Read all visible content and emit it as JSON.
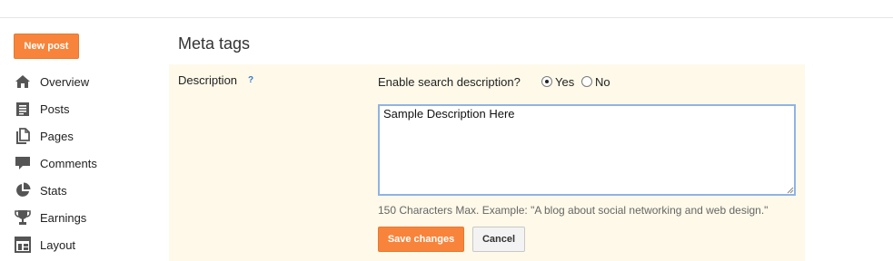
{
  "sidebar": {
    "new_post_label": "New post",
    "items": [
      {
        "label": "Overview",
        "icon": "home-icon"
      },
      {
        "label": "Posts",
        "icon": "posts-icon"
      },
      {
        "label": "Pages",
        "icon": "pages-icon"
      },
      {
        "label": "Comments",
        "icon": "comment-icon"
      },
      {
        "label": "Stats",
        "icon": "pie-chart-icon"
      },
      {
        "label": "Earnings",
        "icon": "trophy-icon"
      },
      {
        "label": "Layout",
        "icon": "layout-icon"
      }
    ]
  },
  "main": {
    "section_title": "Meta tags",
    "description_label": "Description",
    "help_glyph": "?",
    "enable_question": "Enable search description?",
    "options": [
      {
        "label": "Yes",
        "checked": true
      },
      {
        "label": "No",
        "checked": false
      }
    ],
    "textarea_value": "Sample Description Here",
    "hint": "150 Characters Max. Example: \"A blog about social networking and web design.\"",
    "save_label": "Save changes",
    "cancel_label": "Cancel"
  },
  "colors": {
    "accent_orange": "#f8843b",
    "panel_bg": "#fef9e9",
    "focus_blue": "#8fb3e6",
    "icon_gray": "#555555"
  }
}
